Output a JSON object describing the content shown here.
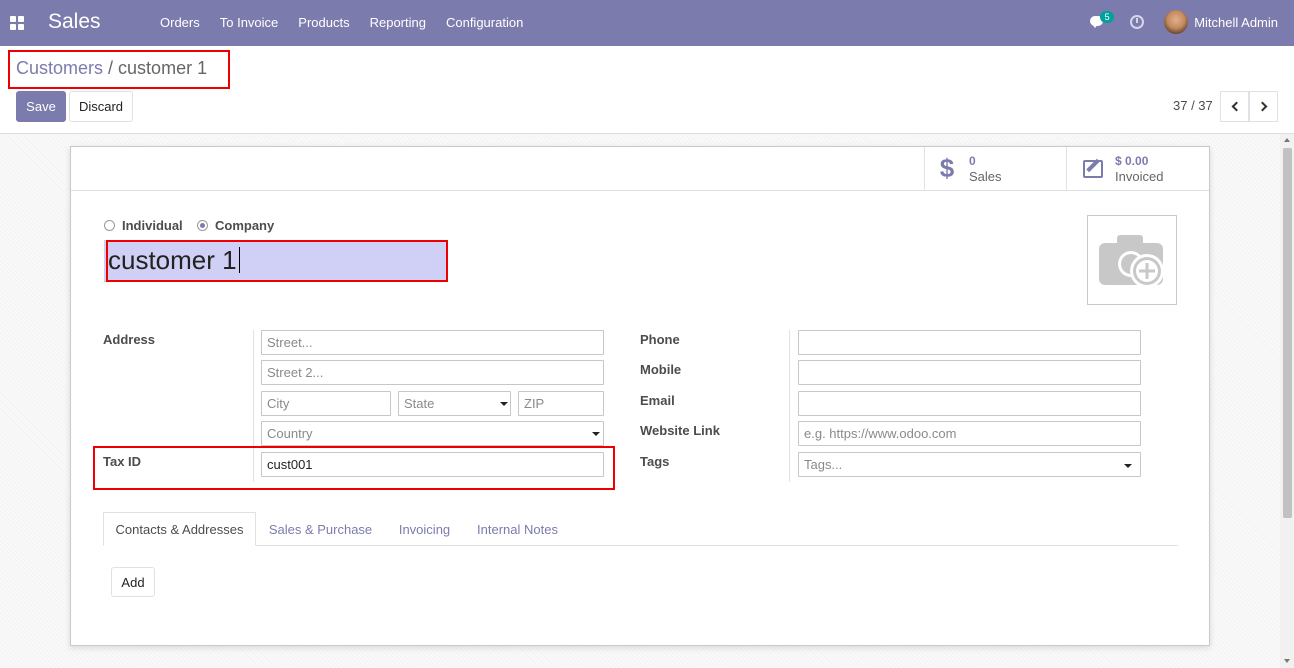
{
  "navbar": {
    "app_name": "Sales",
    "menu": [
      "Orders",
      "To Invoice",
      "Products",
      "Reporting",
      "Configuration"
    ],
    "message_count": "5",
    "user_name": "Mitchell Admin"
  },
  "breadcrumb": {
    "parent": "Customers",
    "separator": "/",
    "current": "customer 1"
  },
  "actions": {
    "save_label": "Save",
    "discard_label": "Discard"
  },
  "pager": {
    "value": "37 / 37"
  },
  "stat_buttons": {
    "sales_value": "0",
    "sales_label": "Sales",
    "invoiced_value": "$ 0.00",
    "invoiced_label": "Invoiced"
  },
  "company_type": {
    "individual_label": "Individual",
    "company_label": "Company",
    "selected": "Company"
  },
  "partner": {
    "name": "customer 1"
  },
  "address": {
    "label": "Address",
    "street_placeholder": "Street...",
    "street2_placeholder": "Street 2...",
    "city_placeholder": "City",
    "state_placeholder": "State",
    "zip_placeholder": "ZIP",
    "country_placeholder": "Country"
  },
  "tax": {
    "label": "Tax ID",
    "value": "cust001"
  },
  "contact": {
    "phone_label": "Phone",
    "mobile_label": "Mobile",
    "email_label": "Email",
    "website_label": "Website Link",
    "website_placeholder": "e.g. https://www.odoo.com",
    "tags_label": "Tags",
    "tags_placeholder": "Tags..."
  },
  "tabs": [
    "Contacts & Addresses",
    "Sales & Purchase",
    "Invoicing",
    "Internal Notes"
  ],
  "tab_content": {
    "add_label": "Add"
  },
  "colors": {
    "brand": "#7c7bad",
    "highlight_box": "#e00000",
    "badge": "#00a09d"
  }
}
